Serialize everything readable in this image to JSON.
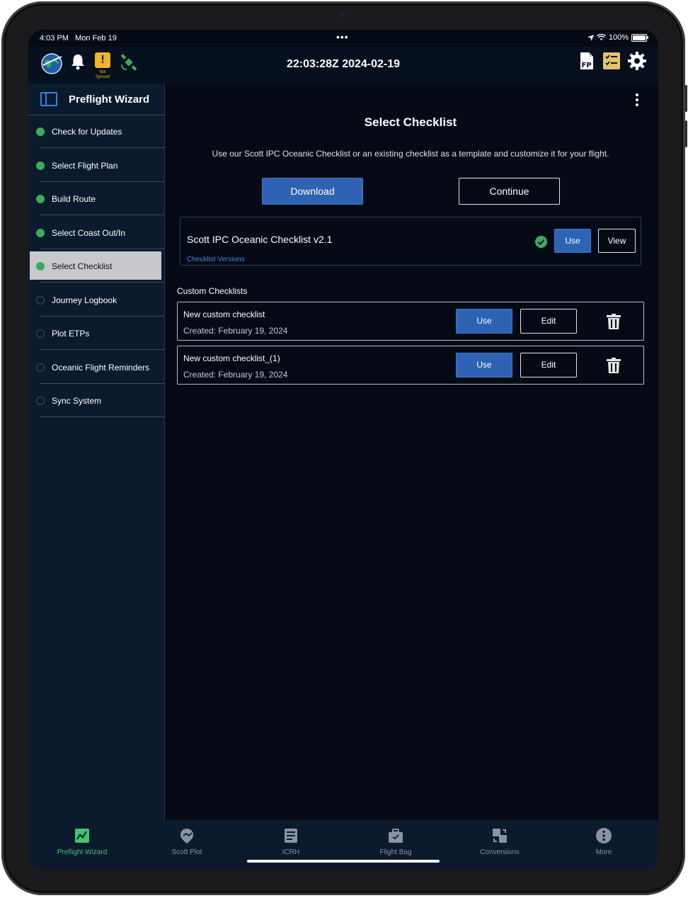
{
  "status_bar": {
    "time": "4:03 PM",
    "date": "Mon Feb 19",
    "battery": "100%"
  },
  "header": {
    "clock": "22:03:28Z  2024-02-19",
    "sync_status": "Not Synced",
    "icons": [
      "globe-logo-icon",
      "bell-icon",
      "warning-icon",
      "satellite-icon",
      "flight-plan-file-icon",
      "checklist-icon",
      "gear-icon"
    ]
  },
  "sidebar": {
    "title": "Preflight Wizard",
    "items": [
      {
        "label": "Check for Updates",
        "done": true
      },
      {
        "label": "Select Flight Plan",
        "done": true
      },
      {
        "label": "Build Route",
        "done": true
      },
      {
        "label": "Select Coast Out/In",
        "done": true
      },
      {
        "label": "Select Checklist",
        "done": true,
        "active": true
      },
      {
        "label": "Journey Logbook",
        "done": false
      },
      {
        "label": "Plot ETPs",
        "done": false
      },
      {
        "label": "Oceanic Flight Reminders",
        "done": false
      },
      {
        "label": "Sync System",
        "done": false
      }
    ]
  },
  "main": {
    "title": "Select Checklist",
    "description": "Use our Scott IPC Oceanic Checklist or an existing checklist as a template and customize it for your flight.",
    "download_label": "Download",
    "continue_label": "Continue",
    "scott_card": {
      "name": "Scott IPC Oceanic Checklist v2.1",
      "versions_link": "Checklist Versions",
      "use_label": "Use",
      "view_label": "View"
    },
    "custom_title": "Custom Checklists",
    "custom": [
      {
        "name": "New custom checklist",
        "created": "Created: February 19, 2024",
        "use_label": "Use",
        "edit_label": "Edit"
      },
      {
        "name": "New custom checklist_(1)",
        "created": "Created: February 19, 2024",
        "use_label": "Use",
        "edit_label": "Edit"
      }
    ]
  },
  "tabs": [
    {
      "label": "Preflight Wizard",
      "active": true
    },
    {
      "label": "Scott Plot"
    },
    {
      "label": "ICRH"
    },
    {
      "label": "Flight Bag"
    },
    {
      "label": "Conversions"
    },
    {
      "label": "More"
    }
  ],
  "colors": {
    "accent_blue": "#2e62b3",
    "done_green": "#3daa5f",
    "warning_yellow": "#f0b429",
    "background": "#050a14"
  }
}
